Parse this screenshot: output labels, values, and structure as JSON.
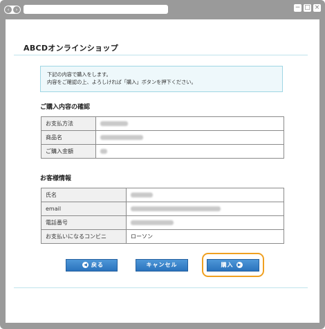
{
  "window": {
    "nav_back_icon": "‹",
    "nav_forward_icon": "›",
    "minimize_icon": "−",
    "restore_icon": "□",
    "close_icon": "×"
  },
  "site_title": "ABCDオンラインショップ",
  "notice": {
    "line1": "下記の内容で購入をします。",
    "line2": "内容をご確認の上、よろしければ「購入」ボタンを押下ください。"
  },
  "purchase": {
    "heading": "ご購入内容の確認",
    "rows": [
      {
        "label": "お支払方法",
        "value": ""
      },
      {
        "label": "商品名",
        "value": ""
      },
      {
        "label": "ご購入金額",
        "value": ""
      }
    ]
  },
  "customer": {
    "heading": "お客様情報",
    "rows": [
      {
        "label": "氏名",
        "value": ""
      },
      {
        "label": "email",
        "value": ""
      },
      {
        "label": "電話番号",
        "value": ""
      },
      {
        "label": "お支払いになるコンビニ",
        "value": "ローソン"
      }
    ]
  },
  "buttons": {
    "back": "戻る",
    "cancel": "キャンセル",
    "purchase": "購入",
    "back_icon": "◀",
    "purchase_icon": "▶"
  },
  "colors": {
    "accent": "#2a73bd",
    "highlight": "#f0a020"
  }
}
